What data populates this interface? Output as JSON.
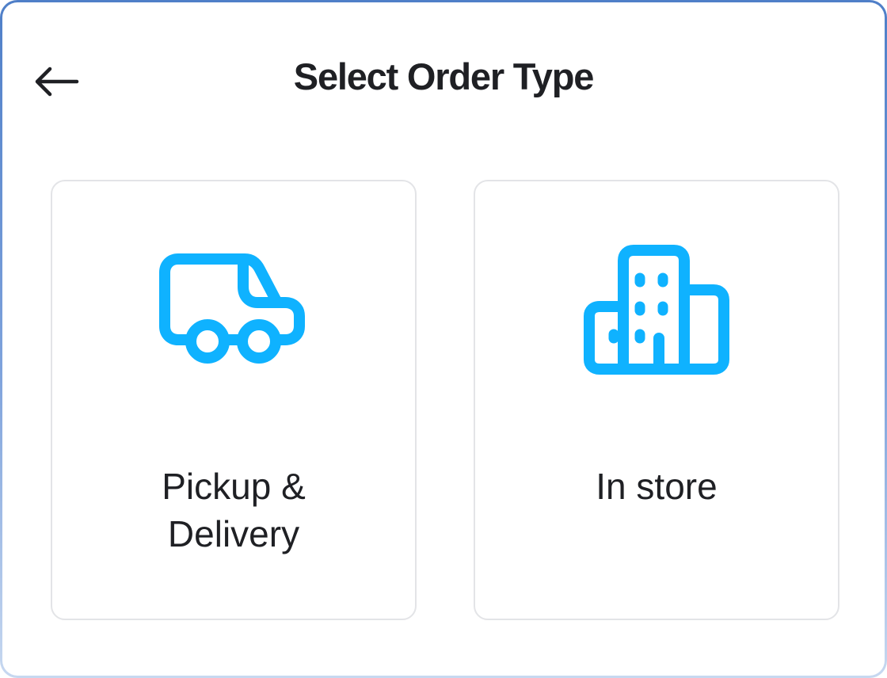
{
  "header": {
    "title": "Select Order Type",
    "back_icon": "arrow-left-icon"
  },
  "options": [
    {
      "label": "Pickup &\nDelivery",
      "icon": "truck-icon"
    },
    {
      "label": "In store",
      "icon": "building-icon"
    }
  ],
  "colors": {
    "accent": "#0fb2ff",
    "text": "#1f2024",
    "card_border": "#e3e4e7",
    "frame_border": "#5b86cc"
  }
}
